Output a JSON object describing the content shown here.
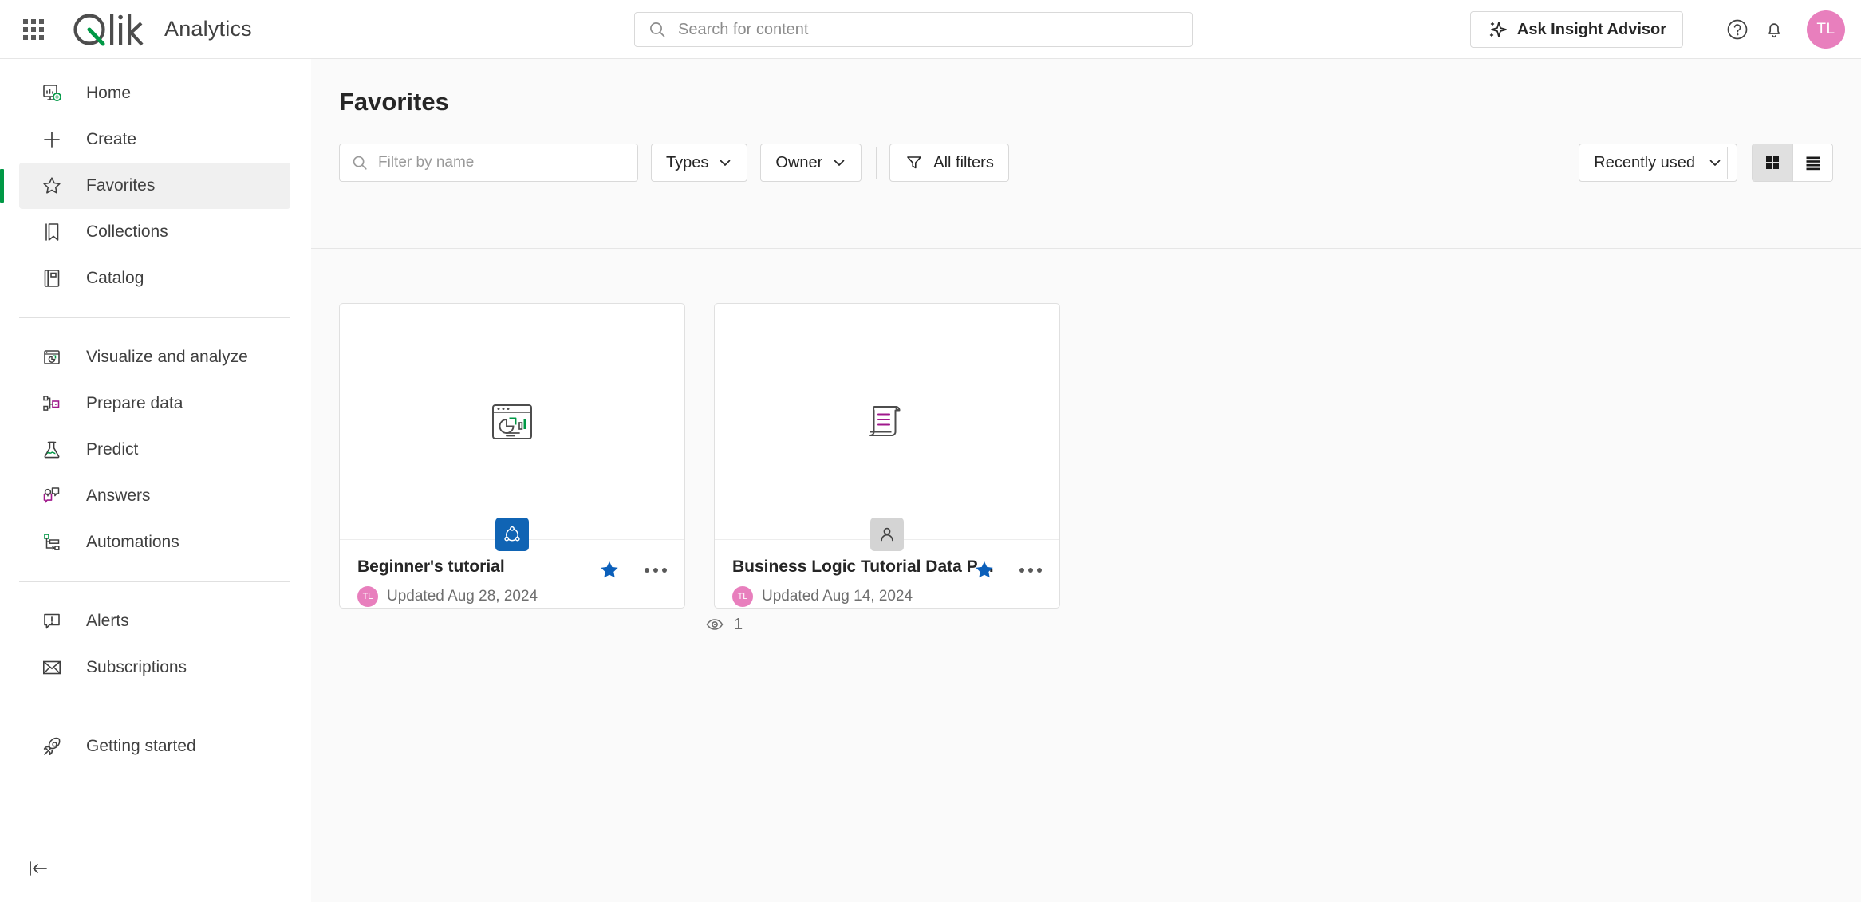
{
  "header": {
    "waffle_icon": "app-launcher-icon",
    "brand_name": "Qlik",
    "app_title": "Analytics",
    "search": {
      "placeholder": "Search for content",
      "value": "",
      "icon": "search-icon"
    },
    "insight_advisor_label": "Ask Insight Advisor",
    "insight_icon": "sparkle-icon",
    "help_icon": "help-circle-icon",
    "notifications_icon": "bell-icon",
    "avatar_initials": "TL",
    "avatar_color": "#e87fbd"
  },
  "sidebar": {
    "groups": [
      {
        "items": [
          {
            "label": "Home",
            "icon": "home-dashboard-icon",
            "active": false
          },
          {
            "label": "Create",
            "icon": "plus-icon",
            "active": false
          },
          {
            "label": "Favorites",
            "icon": "star-outline-icon",
            "active": true
          },
          {
            "label": "Collections",
            "icon": "bookmark-icon",
            "active": false
          },
          {
            "label": "Catalog",
            "icon": "book-icon",
            "active": false
          }
        ]
      },
      {
        "items": [
          {
            "label": "Visualize and analyze",
            "icon": "chart-window-icon",
            "active": false
          },
          {
            "label": "Prepare data",
            "icon": "data-prep-icon",
            "active": false
          },
          {
            "label": "Predict",
            "icon": "flask-icon",
            "active": false
          },
          {
            "label": "Answers",
            "icon": "answers-chat-icon",
            "active": false
          },
          {
            "label": "Automations",
            "icon": "automations-flow-icon",
            "active": false
          }
        ]
      },
      {
        "items": [
          {
            "label": "Alerts",
            "icon": "alert-bubble-icon",
            "active": false
          },
          {
            "label": "Subscriptions",
            "icon": "envelope-icon",
            "active": false
          }
        ]
      },
      {
        "items": [
          {
            "label": "Getting started",
            "icon": "rocket-icon",
            "active": false
          }
        ]
      }
    ],
    "collapse_icon": "collapse-left-icon",
    "active_accent_color": "#009845"
  },
  "main": {
    "page_title": "Favorites",
    "toolbar": {
      "filter_placeholder": "Filter by name",
      "filter_value": "",
      "filter_icon": "search-icon",
      "types_label": "Types",
      "owner_label": "Owner",
      "all_filters_label": "All filters",
      "all_filters_icon": "funnel-icon",
      "chevron_icon": "chevron-down-icon",
      "sort_label": "Recently used",
      "grid_view_icon": "grid-view-icon",
      "list_view_icon": "list-view-icon",
      "active_view": "grid"
    },
    "cards": [
      {
        "title": "Beginner's tutorial",
        "meta": "Updated Aug 28, 2024",
        "owner_initials": "TL",
        "thumb_icon": "chart-window-icon",
        "badge_icon": "qlik-app-icon",
        "badge_type": "app",
        "badge_color": "#1064b4",
        "favorited": true,
        "star_icon": "star-filled-icon",
        "more_icon": "more-horizontal-icon"
      },
      {
        "title": "Business Logic Tutorial Data Prep",
        "meta": "Updated Aug 14, 2024",
        "owner_initials": "TL",
        "thumb_icon": "script-scroll-icon",
        "badge_icon": "person-icon",
        "badge_type": "user",
        "badge_color": "#d4d4d4",
        "favorited": true,
        "star_icon": "star-filled-icon",
        "more_icon": "more-horizontal-icon"
      }
    ],
    "view_count": {
      "icon": "eye-icon",
      "value": "1"
    }
  },
  "colors": {
    "qlik_green": "#009845",
    "accent_blue": "#0b5fba",
    "badge_blue": "#1064b4",
    "magenta": "#a0198c",
    "page_bg": "#fafafa"
  }
}
